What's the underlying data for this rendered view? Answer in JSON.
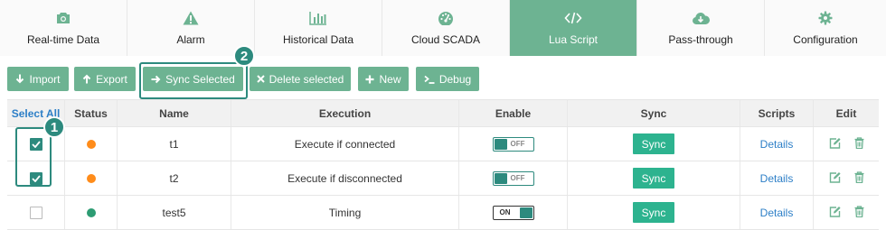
{
  "tabs": [
    {
      "label": "Real-time Data",
      "icon": "camera-icon",
      "active": false
    },
    {
      "label": "Alarm",
      "icon": "warning-icon",
      "active": false
    },
    {
      "label": "Historical Data",
      "icon": "bar-chart-icon",
      "active": false
    },
    {
      "label": "Cloud SCADA",
      "icon": "dashboard-gauge-icon",
      "active": false
    },
    {
      "label": "Lua Script",
      "icon": "code-icon",
      "active": true
    },
    {
      "label": "Pass-through",
      "icon": "cloud-download-icon",
      "active": false
    },
    {
      "label": "Configuration",
      "icon": "gear-icon",
      "active": false
    }
  ],
  "toolbar": {
    "import_label": "Import",
    "export_label": "Export",
    "sync_selected_label": "Sync Selected",
    "delete_selected_label": "Delete selected",
    "new_label": "New",
    "debug_label": "Debug"
  },
  "callouts": {
    "one": "1",
    "two": "2"
  },
  "table": {
    "headers": {
      "select_all": "Select All",
      "status": "Status",
      "name": "Name",
      "execution": "Execution",
      "enable": "Enable",
      "sync": "Sync",
      "scripts": "Scripts",
      "edit": "Edit"
    },
    "rows": [
      {
        "checked": true,
        "status_color": "#ff8c1a",
        "name": "t1",
        "execution": "Execute if connected",
        "enable": "OFF",
        "sync": "Sync",
        "scripts": "Details"
      },
      {
        "checked": true,
        "status_color": "#ff8c1a",
        "name": "t2",
        "execution": "Execute if disconnected",
        "enable": "OFF",
        "sync": "Sync",
        "scripts": "Details"
      },
      {
        "checked": false,
        "status_color": "#2d9c73",
        "name": "test5",
        "execution": "Timing",
        "enable": "ON",
        "sync": "Sync",
        "scripts": "Details"
      }
    ]
  },
  "colors": {
    "accent": "#6db392",
    "accent_dark": "#2d8a7e",
    "sync_button": "#2db38f",
    "link": "#2d7fc7",
    "status_orange": "#ff8c1a",
    "status_green": "#2d9c73"
  }
}
